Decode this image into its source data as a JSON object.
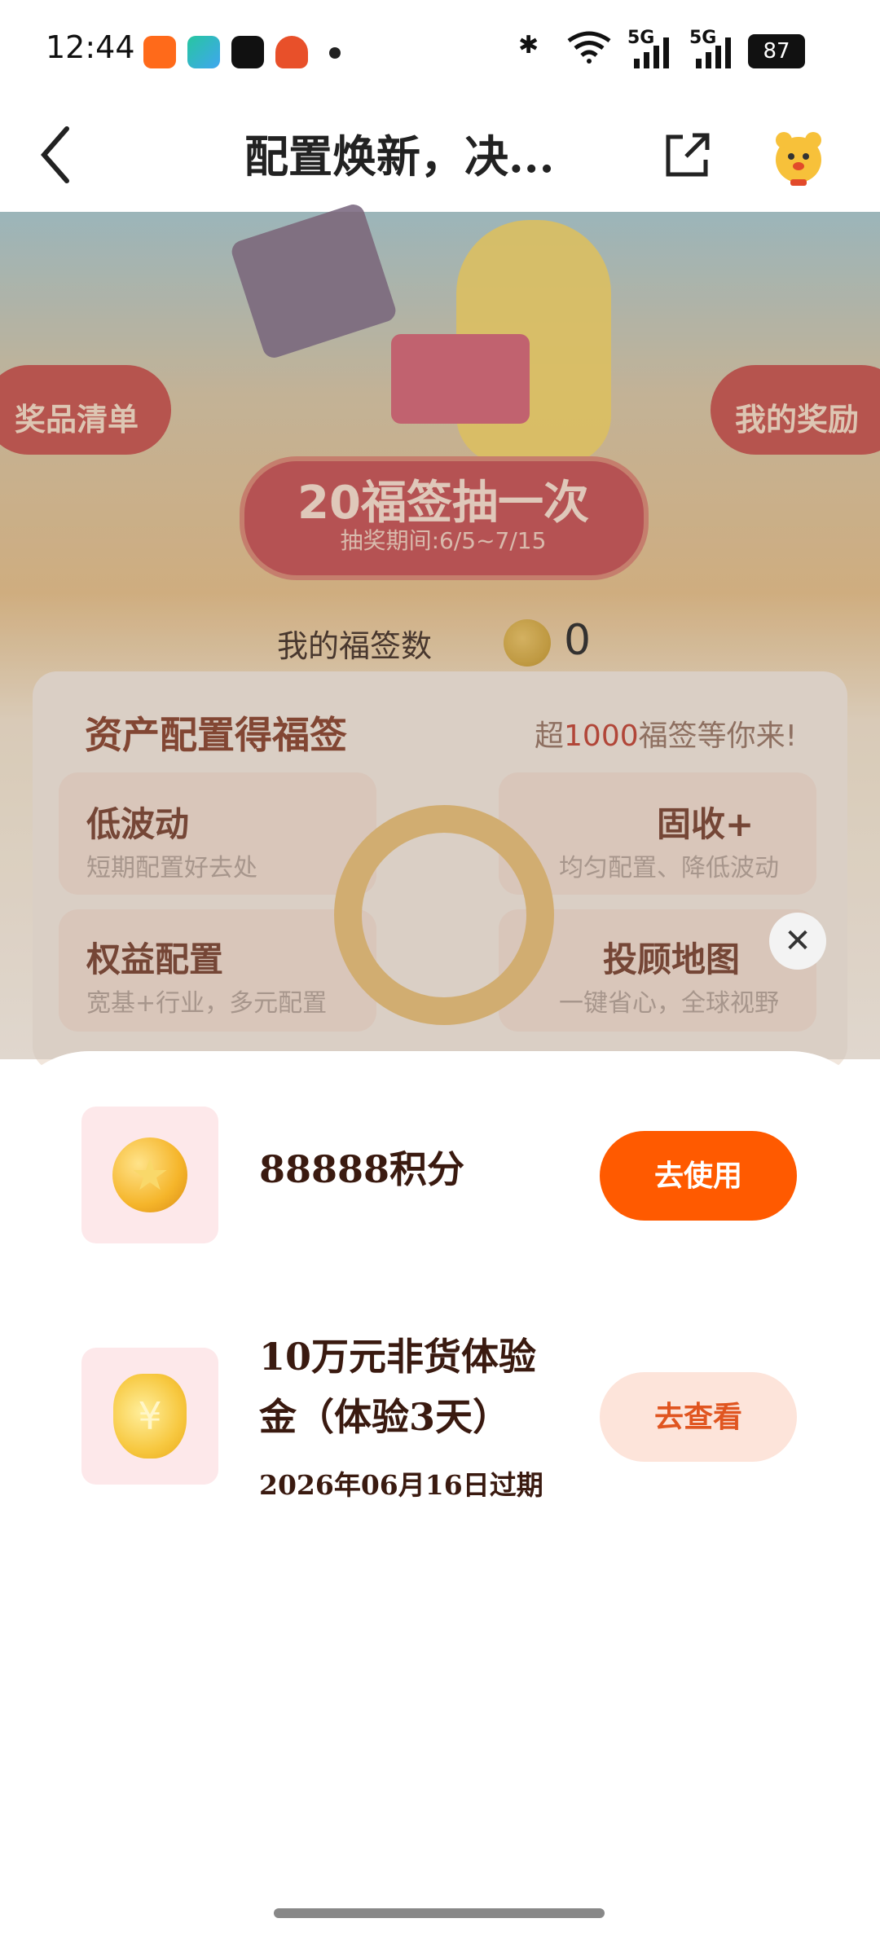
{
  "status": {
    "time": "12:44",
    "signal1": "5G",
    "signal2": "5G",
    "battery": "87"
  },
  "header": {
    "title": "配置焕新，决..."
  },
  "activity": {
    "prize_list": "奖品清单",
    "my_rewards": "我的奖励",
    "draw_title": "20福签抽一次",
    "draw_period": "抽奖期间:6/5~7/15",
    "my_tickets_label": "我的福签数",
    "my_tickets_count": "0",
    "section_title": "资产配置得福签",
    "section_promo_prefix": "超",
    "section_promo_num": "1000",
    "section_promo_suffix": "福签等你来!",
    "tiles": [
      {
        "title": "低波动",
        "subtitle": "短期配置好去处"
      },
      {
        "title": "固收+",
        "subtitle": "均匀配置、降低波动"
      },
      {
        "title": "权益配置",
        "subtitle": "宽基+行业，多元配置"
      },
      {
        "title": "投顾地图",
        "subtitle": "一键省心，全球视野"
      }
    ]
  },
  "sheet": {
    "rewards": [
      {
        "name": "88888积分",
        "button": "去使用",
        "icon": "coin-icon"
      },
      {
        "name_line1": "10万元非货体验",
        "name_line2": "金（体验3天）",
        "expire": "2026年06月16日过期",
        "button": "去查看",
        "icon": "money-bag-icon"
      }
    ]
  }
}
